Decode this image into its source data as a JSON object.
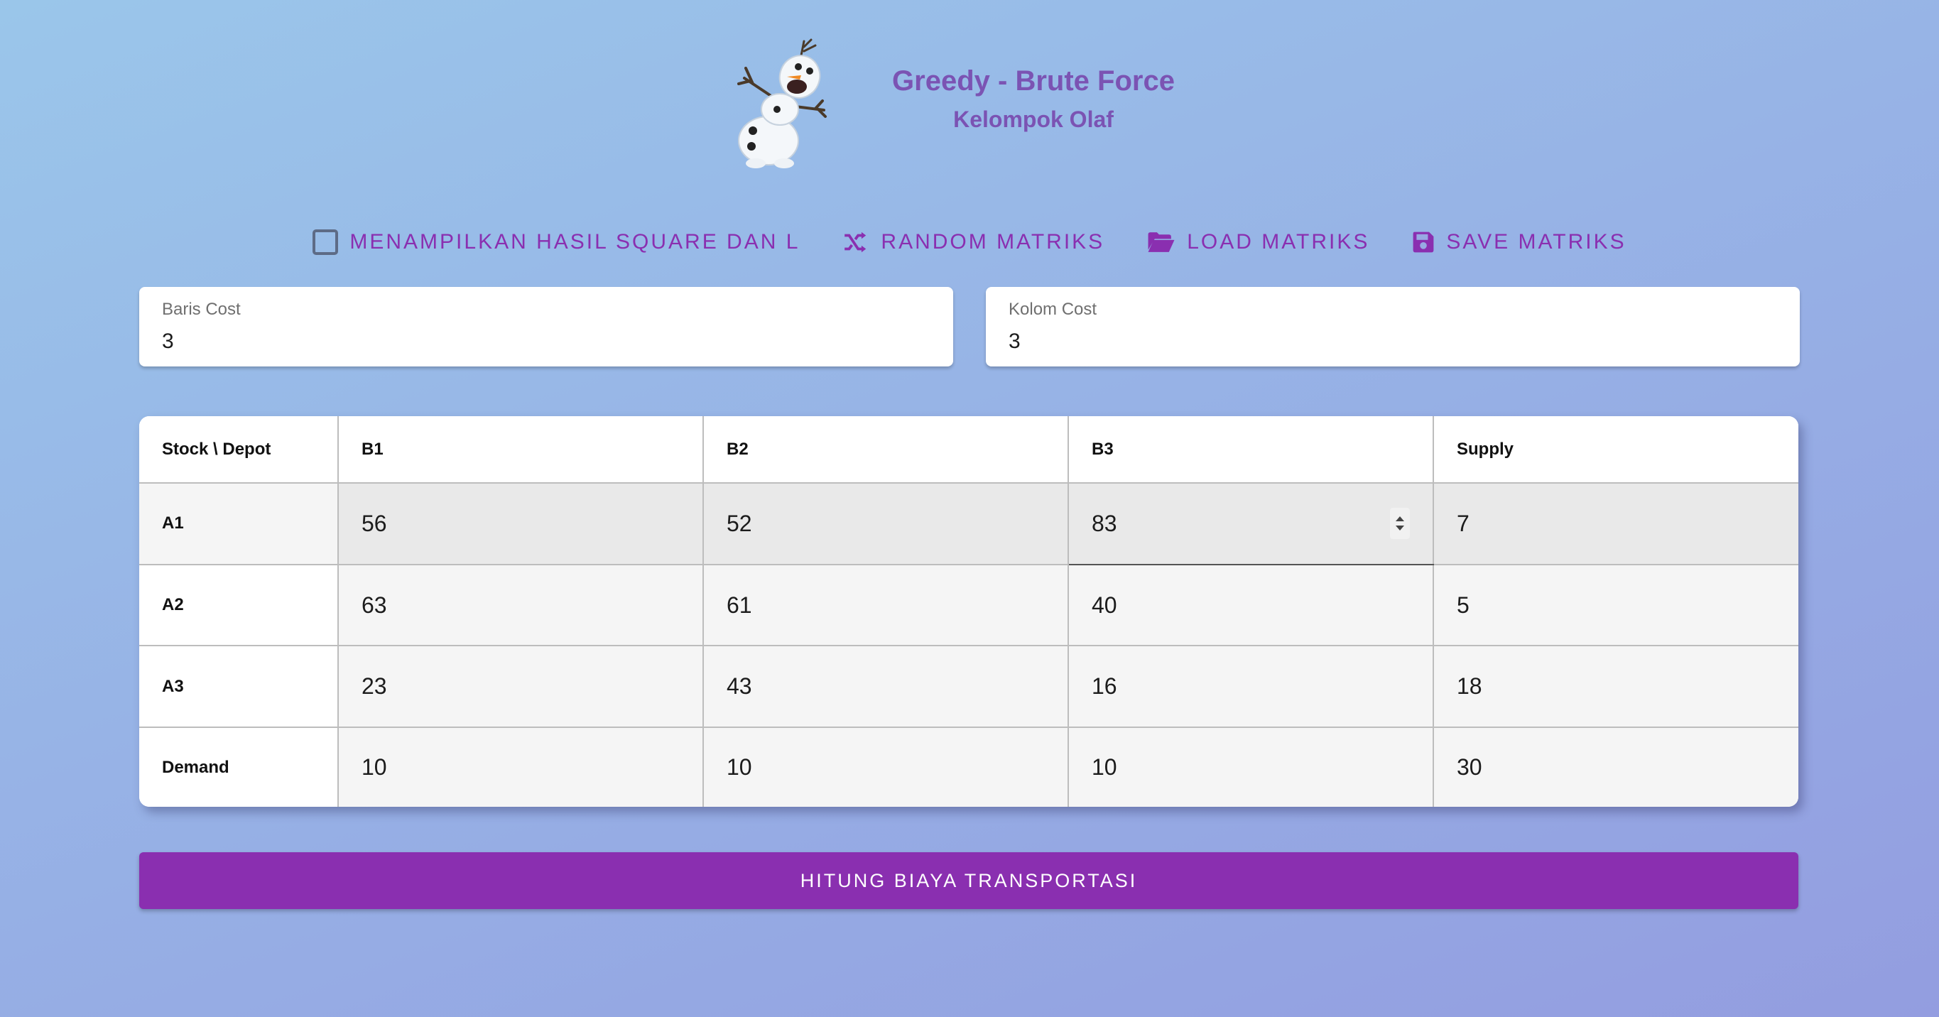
{
  "header": {
    "title": "Greedy - Brute Force",
    "subtitle": "Kelompok Olaf",
    "logo_icon": "olaf-snowman-icon"
  },
  "toolbar": {
    "show_result_label": "Menampilkan Hasil Square dan L",
    "show_result_checked": false,
    "random_label": "Random Matriks",
    "load_label": "Load Matriks",
    "save_label": "Save Matriks",
    "accent_color": "#8a2fb0"
  },
  "fields": {
    "rows_label": "Baris Cost",
    "rows_value": "3",
    "cols_label": "Kolom Cost",
    "cols_value": "3"
  },
  "table": {
    "headers": [
      "Stock \\ Depot",
      "B1",
      "B2",
      "B3",
      "Supply"
    ],
    "rows": [
      {
        "label": "A1",
        "values": [
          "56",
          "52",
          "83",
          "7"
        ]
      },
      {
        "label": "A2",
        "values": [
          "63",
          "61",
          "40",
          "5"
        ]
      },
      {
        "label": "A3",
        "values": [
          "23",
          "43",
          "16",
          "18"
        ]
      },
      {
        "label": "Demand",
        "values": [
          "10",
          "10",
          "10",
          "30"
        ]
      }
    ]
  },
  "action": {
    "compute_label": "HITUNG BIAYA TRANSPORTASI"
  }
}
